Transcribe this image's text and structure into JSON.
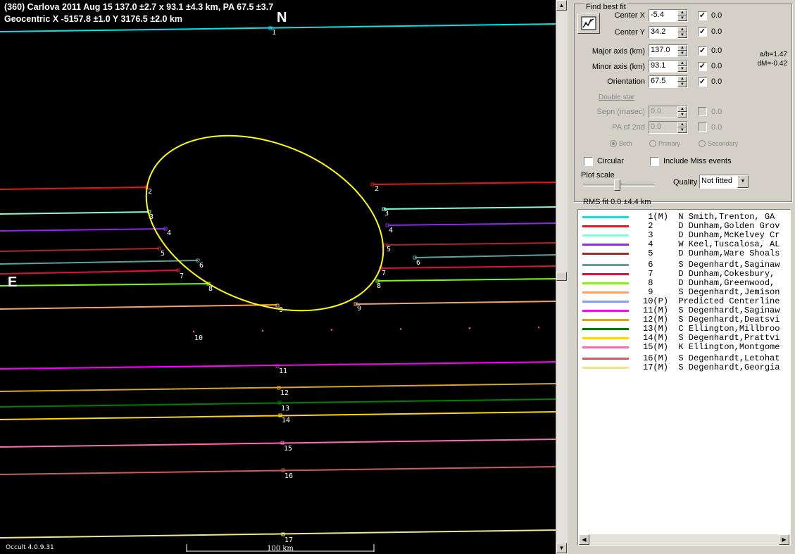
{
  "header": {
    "line1": "(360) Carlova  2011 Aug 15   137.0 ±2.7 x 93.1 ±4.3 km, PA 67.5 ±3.7",
    "line2": "Geocentric  X  -5157.8 ±1.0  Y 3176.5 ±2.0 km"
  },
  "compass": {
    "north": "N",
    "east": "E"
  },
  "version": "Occult 4.0.9.31",
  "scale_label": "100 km",
  "colors": {
    "ellipse": "#ffff00",
    "c1": "#00e5e5",
    "c2": "#e8141c",
    "c3": "#7fffd4",
    "c4": "#8a2be2",
    "c5": "#a52a2a",
    "c6": "#5f9ea0",
    "c7": "#dc143c",
    "c8": "#7cfc00",
    "c9": "#f4a460",
    "c10": "#7f9fff",
    "c11": "#ff00ff",
    "c12": "#daa520",
    "c13": "#008000",
    "c14": "#ffd700",
    "c15": "#ff69b4",
    "c16": "#cd5c5c",
    "c17": "#f0e68c"
  },
  "chords": [
    {
      "id": "1",
      "status": "M"
    },
    {
      "id": "2"
    },
    {
      "id": "3"
    },
    {
      "id": "4"
    },
    {
      "id": "5"
    },
    {
      "id": "6"
    },
    {
      "id": "7"
    },
    {
      "id": "8"
    },
    {
      "id": "9"
    },
    {
      "id": "10"
    },
    {
      "id": "11"
    },
    {
      "id": "12"
    },
    {
      "id": "13"
    },
    {
      "id": "14"
    },
    {
      "id": "15"
    },
    {
      "id": "16"
    },
    {
      "id": "17"
    }
  ],
  "panel": {
    "title": "Find best fit",
    "center_x": {
      "label": "Center X",
      "value": "-5.4",
      "checked": true,
      "extra": "0.0"
    },
    "center_y": {
      "label": "Center Y",
      "value": "34.2",
      "checked": true,
      "extra": "0.0"
    },
    "major": {
      "label": "Major axis (km)",
      "value": "137.0",
      "checked": true,
      "extra": "0.0"
    },
    "minor": {
      "label": "Minor axis (km)",
      "value": "93.1",
      "checked": true,
      "extra": "0.0"
    },
    "orient": {
      "label": "Orientation",
      "value": "67.5",
      "checked": true,
      "extra": "0.0"
    },
    "ratio": "a/b=1.47",
    "dm": "dM=-0.42",
    "double_star": "Double star",
    "sepn": {
      "label": "Sepn (masec)",
      "value": "0.0",
      "extra": "0.0"
    },
    "pa2": {
      "label": "PA of 2nd",
      "value": "0.0",
      "extra": "0.0"
    },
    "radio_both": "Both",
    "radio_primary": "Primary",
    "radio_secondary": "Secondary",
    "circular": "Circular",
    "include_miss": "Include Miss events",
    "plot_scale": "Plot scale",
    "quality_label": "Quality",
    "quality_value": "Not fitted",
    "rms": "RMS fit  0.0 ±4.4 km"
  },
  "legend": [
    {
      "text": "  1(M)  N Smith,Trenton, GA",
      "color": "#00e5e5"
    },
    {
      "text": "  2     D Dunham,Golden Grov",
      "color": "#e8141c"
    },
    {
      "text": "  3     D Dunham,McKelvey Cr",
      "color": "#7fffd4"
    },
    {
      "text": "  4     W Keel,Tuscalosa, AL",
      "color": "#8a2be2"
    },
    {
      "text": "  5     D Dunham,Ware Shoals",
      "color": "#a52a2a"
    },
    {
      "text": "  6     S Degenhardt,Saginaw",
      "color": "#5f9ea0"
    },
    {
      "text": "  7     D Dunham,Cokesbury,",
      "color": "#dc143c"
    },
    {
      "text": "  8     D Dunham,Greenwood,",
      "color": "#7cfc00"
    },
    {
      "text": "  9     S Degenhardt,Jemison",
      "color": "#f4a460"
    },
    {
      "text": " 10(P)  Predicted Centerline",
      "color": "#7f9fff"
    },
    {
      "text": " 11(M)  S Degenhardt,Saginaw",
      "color": "#ff00ff"
    },
    {
      "text": " 12(M)  S Degenhardt,Deatsvi",
      "color": "#daa520"
    },
    {
      "text": " 13(M)  C Ellington,Millbroo",
      "color": "#008000"
    },
    {
      "text": " 14(M)  S Degenhardt,Prattvi",
      "color": "#ffd700"
    },
    {
      "text": " 15(M)  K Ellington,Montgome",
      "color": "#ff69b4"
    },
    {
      "text": " 16(M)  S Degenhardt,Letohat",
      "color": "#cd5c5c"
    },
    {
      "text": " 17(M)  S Degenhardt,Georgia",
      "color": "#f0e68c"
    }
  ]
}
